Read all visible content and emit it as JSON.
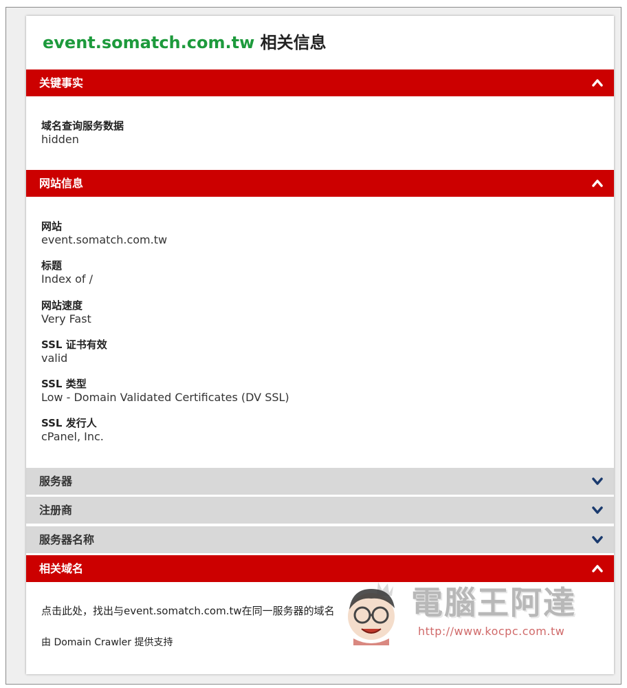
{
  "page": {
    "title_domain": "event.somatch.com.tw",
    "title_suffix": "相关信息"
  },
  "sections": {
    "key_facts": {
      "label": "关键事实",
      "whois_label": "域名查询服务数据",
      "whois_value": "hidden"
    },
    "site_info": {
      "label": "网站信息",
      "fields": [
        {
          "label": "网站",
          "value": "event.somatch.com.tw"
        },
        {
          "label": "标题",
          "value": "Index of /"
        },
        {
          "label": "网站速度",
          "value": "Very Fast"
        },
        {
          "label": "SSL 证书有效",
          "value": "valid"
        },
        {
          "label": "SSL 类型",
          "value": "Low - Domain Validated Certificates (DV SSL)"
        },
        {
          "label": "SSL 发行人",
          "value": "cPanel, Inc."
        }
      ]
    },
    "server": {
      "label": "服务器"
    },
    "registrar": {
      "label": "注册商"
    },
    "server_name": {
      "label": "服务器名称"
    },
    "related": {
      "label": "相关域名",
      "link_text": "点击此处，找出与event.somatch.com.tw在同一服务器的域名",
      "powered_by": "由 Domain Crawler 提供支持"
    }
  },
  "watermark": {
    "brand": "電腦王阿達",
    "url": "http://www.kocpc.com.tw"
  },
  "colors": {
    "accent_red": "#cc0000",
    "collapsed_gray": "#d8d8d8",
    "domain_green": "#1d9a3c",
    "chevron_navy": "#1a3a6e"
  }
}
